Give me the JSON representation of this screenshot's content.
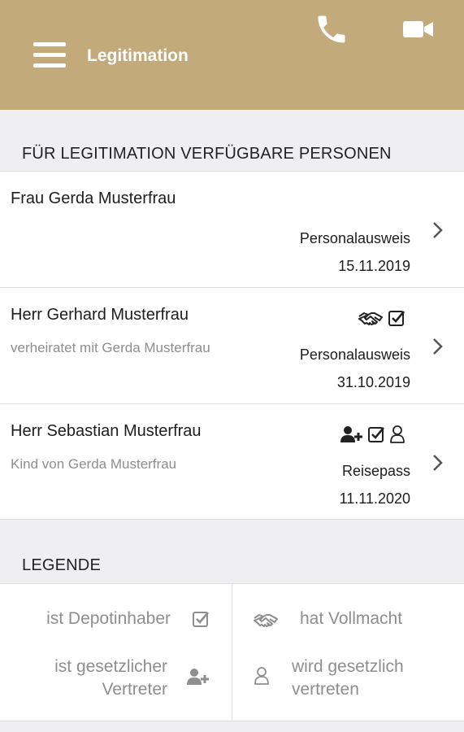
{
  "app_bar": {
    "title": "Legitimation",
    "background": "#c2aa7b",
    "menu_icon": "hamburger-icon",
    "phone_icon": "phone-icon",
    "video_icon": "video-camera-icon"
  },
  "persons_section": {
    "heading": "FÜR LEGITIMATION VERFÜGBARE PERSONEN",
    "persons": [
      {
        "name": "Frau Gerda Musterfrau",
        "relation": "",
        "icons": [],
        "document": "Personalausweis",
        "date": "15.11.2019"
      },
      {
        "name": "Herr Gerhard Musterfrau",
        "relation": "verheiratet mit Gerda Musterfrau",
        "icons": [
          "handshake-icon",
          "checkbox-icon"
        ],
        "document": "Personalausweis",
        "date": "31.10.2019"
      },
      {
        "name": "Herr Sebastian Musterfrau",
        "relation": "Kind von Gerda Musterfrau",
        "icons": [
          "user-add-icon",
          "checkbox-icon",
          "user-outline-icon"
        ],
        "document": "Reisepass",
        "date": "11.11.2020"
      }
    ]
  },
  "legend": {
    "heading": "LEGENDE",
    "depotinhaber": "ist Depotinhaber",
    "vertreter_line1": "ist gesetzlicher",
    "vertreter_line2": "Vertreter",
    "vollmacht": "hat Vollmacht",
    "vertreten_line1": "wird gesetzlich",
    "vertreten_line2": "vertreten"
  }
}
